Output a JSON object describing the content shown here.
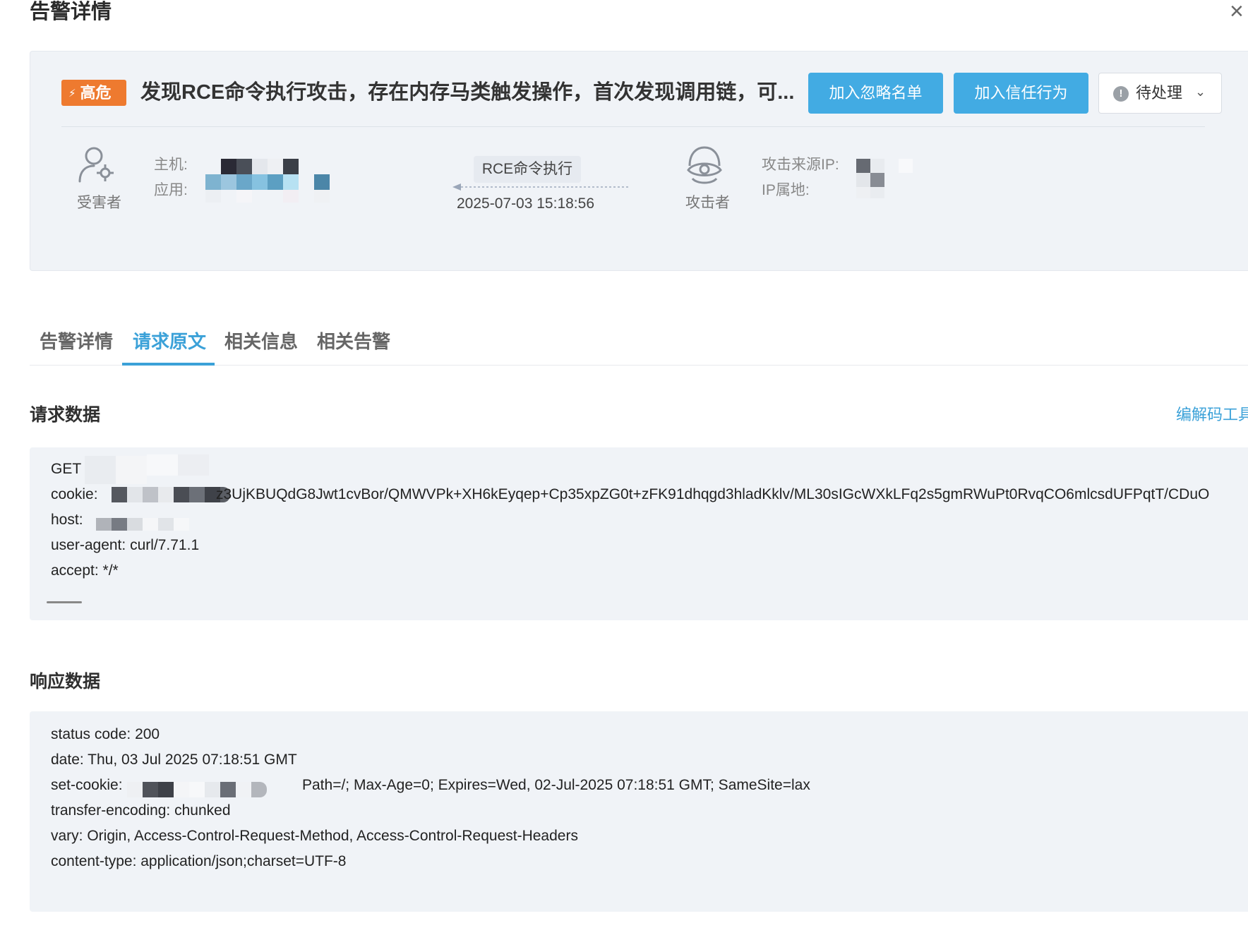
{
  "dialog": {
    "title": "告警详情",
    "close_icon": "×"
  },
  "alert": {
    "severity": "高危",
    "severity_icon": "⚡",
    "title": "发现RCE命令执行攻击，存在内存马类触发操作，首次发现调用链，可...",
    "actions": {
      "ignore_label": "加入忽略名单",
      "trust_label": "加入信任行为"
    },
    "status": {
      "label": "待处理",
      "icon": "!",
      "chevron": "⌄"
    },
    "victim": {
      "role_label": "受害者",
      "host_label": "主机:",
      "app_label": "应用:"
    },
    "attack": {
      "type": "RCE命令执行",
      "time": "2025-07-03 15:18:56"
    },
    "attacker": {
      "role_label": "攻击者",
      "source_ip_label": "攻击来源IP:",
      "ip_location_label": "IP属地:"
    }
  },
  "tabs": [
    {
      "label": "告警详情",
      "active": false
    },
    {
      "label": "请求原文",
      "active": true
    },
    {
      "label": "相关信息",
      "active": false
    },
    {
      "label": "相关告警",
      "active": false
    }
  ],
  "request": {
    "section_title": "请求数据",
    "decode_tool_label": "编解码工具",
    "method": "GET",
    "cookie_label": "cookie:",
    "cookie_value": "z3UjKBUQdG8Jwt1cvBor/QMWVPk+XH6kEyqep+Cp35xpZG0t+zFK91dhqgd3hladKklv/ML30sIGcWXkLFq2s5gmRWuPt0RvqCO6mlcsdUFPqtT/CDuO",
    "host_label": "host:",
    "user_agent": "user-agent: curl/7.71.1",
    "accept": "accept: */*"
  },
  "response": {
    "section_title": "响应数据",
    "status_code": "status code: 200",
    "date": "date: Thu, 03 Jul 2025 07:18:51 GMT",
    "set_cookie_label": "set-cookie:",
    "set_cookie_value": "Path=/; Max-Age=0; Expires=Wed, 02-Jul-2025 07:18:51 GMT; SameSite=lax",
    "transfer_encoding": "transfer-encoding: chunked",
    "vary": "vary: Origin, Access-Control-Request-Method, Access-Control-Request-Headers",
    "content_type": "content-type: application/json;charset=UTF-8"
  },
  "colors": {
    "accent": "#42abe3",
    "severity_high": "#ee7a2f",
    "card_bg": "#f0f3f7"
  }
}
